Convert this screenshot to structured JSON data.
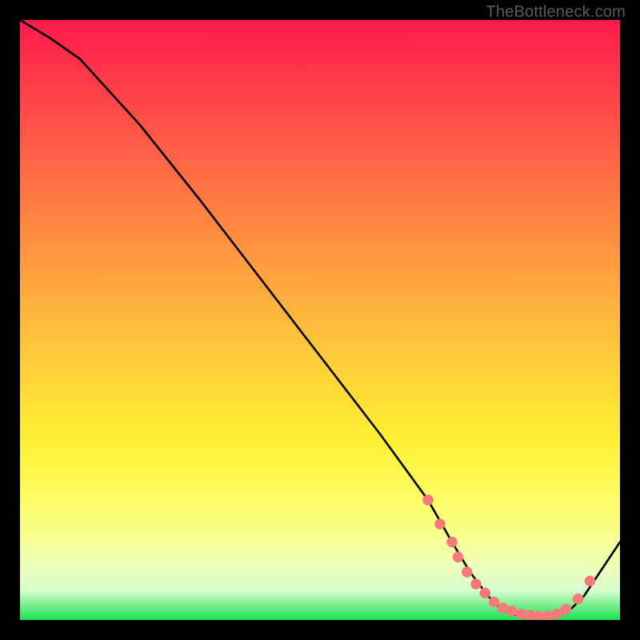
{
  "watermark": "TheBottleneck.com",
  "chart_data": {
    "type": "line",
    "title": "",
    "xlabel": "",
    "ylabel": "",
    "xlim": [
      0,
      100
    ],
    "ylim": [
      0,
      100
    ],
    "grid": false,
    "gradient": {
      "top_color": "#ff1a4a",
      "bottom_color": "#1de050"
    },
    "series": [
      {
        "name": "curve",
        "x": [
          0,
          5,
          10,
          20,
          30,
          40,
          50,
          60,
          68,
          72,
          75,
          78,
          80,
          82,
          84,
          86,
          88,
          90,
          92,
          94,
          96,
          98,
          100
        ],
        "values": [
          100,
          97,
          93.5,
          82.5,
          70,
          57,
          44,
          31,
          20,
          13,
          8,
          4,
          2,
          1,
          0.5,
          0.5,
          0.5,
          1,
          2,
          4,
          7,
          10,
          13
        ]
      }
    ],
    "markers": {
      "name": "valley-dots",
      "x": [
        68,
        70,
        72,
        73,
        74.5,
        76,
        77.5,
        79,
        80.5,
        82,
        83.5,
        85,
        86.5,
        88,
        89.5,
        91,
        93,
        95
      ],
      "values": [
        20,
        16,
        13,
        10.5,
        8,
        6,
        4.5,
        3,
        2,
        1.5,
        1,
        0.8,
        0.7,
        0.7,
        1,
        1.8,
        3.5,
        6.5
      ]
    }
  }
}
